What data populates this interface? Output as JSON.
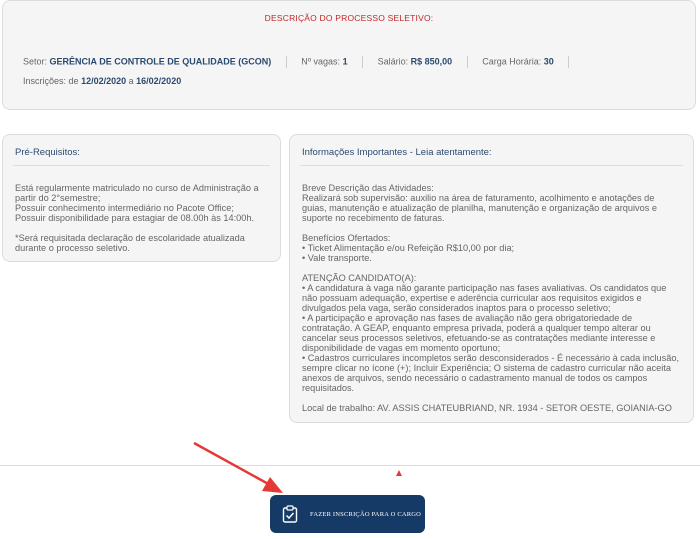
{
  "top": {
    "title": "DESCRIÇÃO DO PROCESSO SELETIVO:",
    "setor_label": "Setor:",
    "setor_value": "GERÊNCIA DE CONTROLE DE QUALIDADE (GCON)",
    "vagas_label": "Nº vagas:",
    "vagas_value": "1",
    "salario_label": "Salário:",
    "salario_value": "R$ 850,00",
    "carga_label": "Carga Horária:",
    "carga_value": "30",
    "inscricoes_label": "Inscrições:",
    "inscricoes_de": "de",
    "inscricoes_start": "12/02/2020",
    "inscricoes_a": "a",
    "inscricoes_end": "16/02/2020"
  },
  "prereq": {
    "title": "Pré-Requisitos:",
    "lines": [
      "Está regularmente matriculado no curso de Administração a",
      "partir do 2°semestre;",
      "Possuir conhecimento intermediário no Pacote Office;",
      "Possuir disponibilidade para estagiar de 08.00h às 14:00h."
    ],
    "note_lines": [
      "*Será requisitada declaração de escolaridade atualizada",
      "durante o processo seletivo."
    ]
  },
  "info": {
    "title": "Informações Importantes - Leia atentamente:",
    "desc_lines": [
      "Breve Descrição das Atividades:",
      "Realizará sob supervisão: auxilio na área de faturamento, acolhimento e anotações de",
      "guias, manutenção e atualização de planilha, manutenção e organização de arquivos e",
      "suporte no recebimento de faturas."
    ],
    "benef_lines": [
      "Benefícios Ofertados:",
      "• Ticket Alimentação e/ou Refeição R$10,00 por dia;",
      "• Vale transporte."
    ],
    "atencao_lines": [
      "ATENÇÃO CANDIDATO(A):",
      "• A candidatura à vaga não garante participação nas fases avaliativas. Os candidatos que",
      "não possuam adequação, expertise e aderência curricular aos requisitos exigidos e",
      "divulgados pela vaga, serão considerados inaptos para o processo seletivo;",
      "• A participação e aprovação nas fases de avaliação não gera obrigatoriedade de",
      "contratação. A GEAP, enquanto empresa privada, poderá a qualquer tempo alterar ou",
      "cancelar seus processos seletivos, efetuando-se as contratações mediante interesse e",
      "disponibilidade de vagas em momento oportuno;",
      "• Cadastros curriculares incompletos serão desconsiderados - É necessário à cada inclusão,",
      "sempre clicar no ícone (+); Incluir Experiência; O sistema de cadastro curricular não aceita",
      "anexos de arquivos, sendo necessário o cadastramento manual de todos os campos",
      "requisitados."
    ],
    "local": "Local de trabalho: AV. ASSIS CHATEUBRIAND, NR.  1934 - SETOR OESTE, GOIANIA-GO"
  },
  "cta": {
    "label": "FAZER INSCRIÇÃO PARA O CARGO",
    "icon": "clipboard-check-icon"
  },
  "colors": {
    "accent_red": "#c0282c",
    "button_blue": "#153a66",
    "heading_blue": "#2b4a6f",
    "annotation_arrow": "#e53935"
  }
}
